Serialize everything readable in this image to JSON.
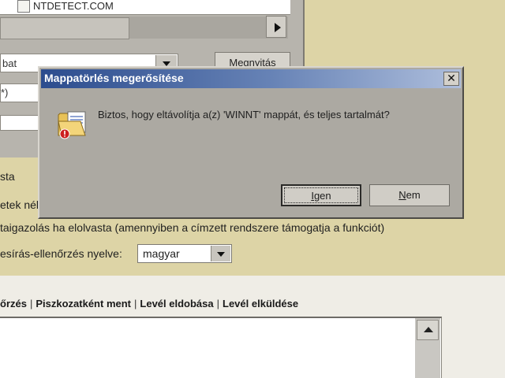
{
  "background_window": {
    "file_name": "NTDETECT.COM",
    "type_select_value": "bat",
    "open_button_label": "Megnyitás",
    "filter_value": "*)"
  },
  "options": {
    "line1": "sta",
    "line2": "etek nél",
    "line3": "taigazolás ha elolvasta (amennyiben a címzett rendszere támogatja a funkciót)",
    "spellcheck_label": "esírás-ellenőrzés nyelve:",
    "spellcheck_value": "magyar"
  },
  "actions": {
    "check": "őrzés",
    "save_draft": "Piszkozatként ment",
    "discard": "Levél eldobása",
    "send": "Levél elküldése"
  },
  "dialog": {
    "title": "Mappatörlés megerősítése",
    "close_label": "✕",
    "message": "Biztos, hogy eltávolítja a(z) 'WINNT' mappát, és teljes tartalmát?",
    "yes_first": "I",
    "yes_rest": "gen",
    "no_first": "N",
    "no_rest": "em"
  },
  "colors": {
    "titlebar_start": "#2c4c8e",
    "dialog_bg": "#aca9a2",
    "page_bg": "#ddd4a6"
  },
  "icons": {
    "folder_delete": "folder-with-document-and-red-warning",
    "file": "file-icon",
    "close": "close-x"
  }
}
